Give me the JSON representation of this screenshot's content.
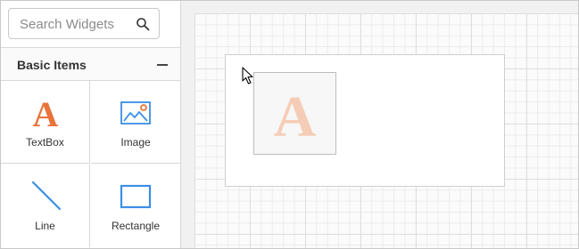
{
  "search": {
    "placeholder": "Search Widgets"
  },
  "section": {
    "title": "Basic Items"
  },
  "items": [
    {
      "label": "TextBox",
      "icon": "textbox-icon"
    },
    {
      "label": "Image",
      "icon": "image-icon"
    },
    {
      "label": "Line",
      "icon": "line-icon"
    },
    {
      "label": "Rectangle",
      "icon": "rectangle-icon"
    }
  ],
  "drag": {
    "glyph": "A",
    "icon": "textbox-drag-preview-icon"
  },
  "colors": {
    "accent_orange": "#e8743b",
    "accent_blue": "#3b8ee8",
    "ghost_orange": "#f5cdb6"
  }
}
